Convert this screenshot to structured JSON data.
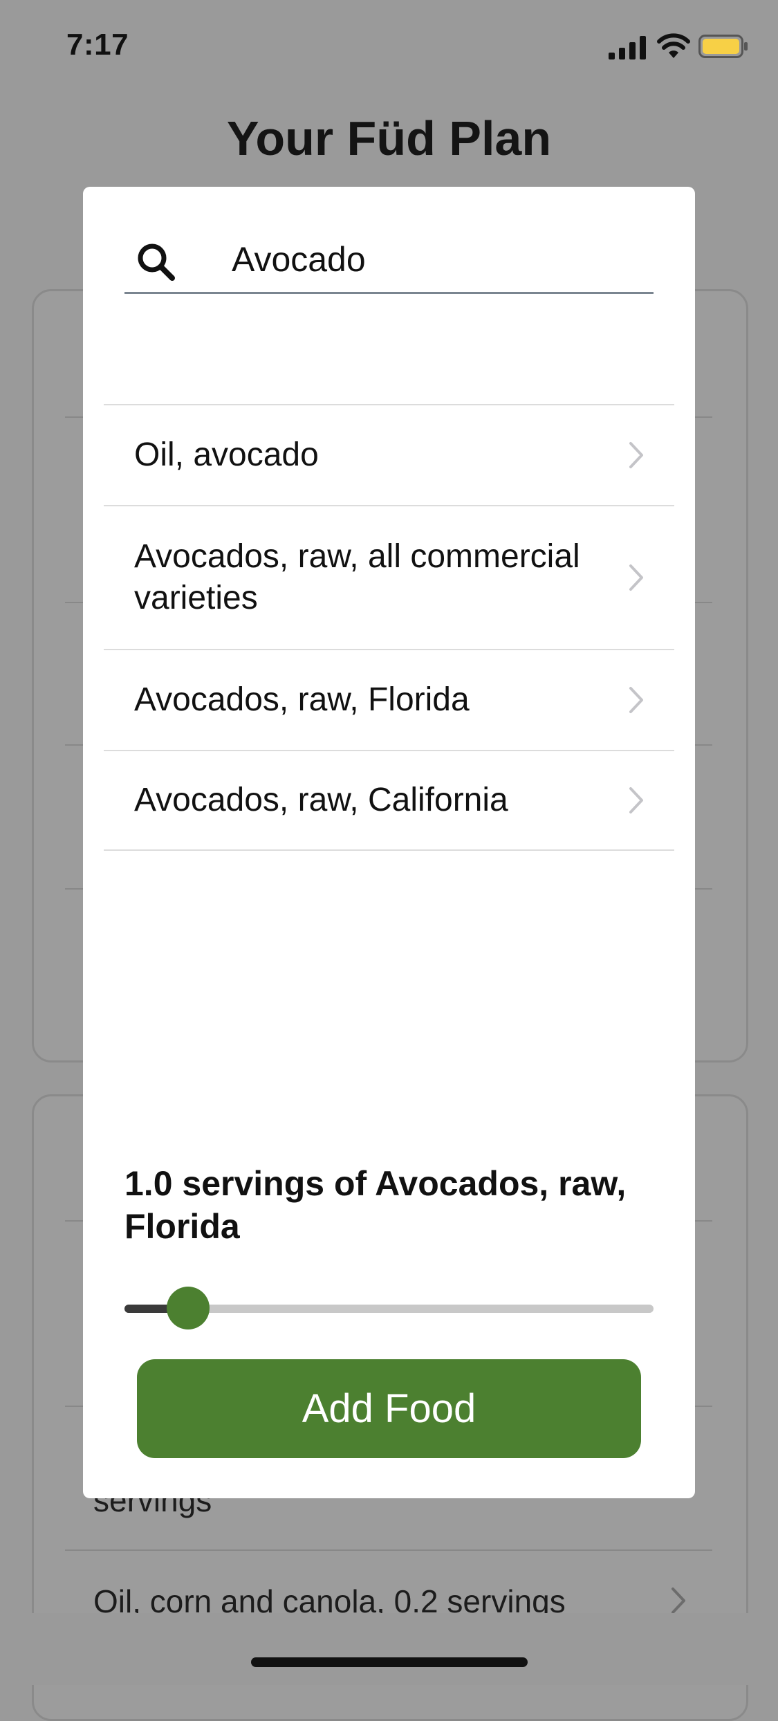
{
  "status_bar": {
    "time": "7:17"
  },
  "page_title": "Your Füd Plan",
  "background_card": {
    "partial_text": "servings",
    "item_text": "Oil, corn and canola, 0.2 servings"
  },
  "modal": {
    "search": {
      "value": "Avocado",
      "placeholder": "Search"
    },
    "results": [
      {
        "label": "Oil, avocado"
      },
      {
        "label": "Avocados, raw, all commercial varieties"
      },
      {
        "label": "Avocados, raw, Florida"
      },
      {
        "label": "Avocados, raw, California"
      }
    ],
    "selection_text": "1.0 servings of Avocados, raw, Florida",
    "servings_slider": {
      "value": 1.0,
      "fraction": 0.12
    },
    "add_button_label": "Add Food"
  },
  "colors": {
    "accent_green": "#4c8030",
    "overlay_gray": "#9a9a9a",
    "battery_yellow": "#f7d046"
  },
  "icons": [
    "signal-icon",
    "wifi-icon",
    "battery-icon",
    "search-icon",
    "chevron-right-icon"
  ]
}
